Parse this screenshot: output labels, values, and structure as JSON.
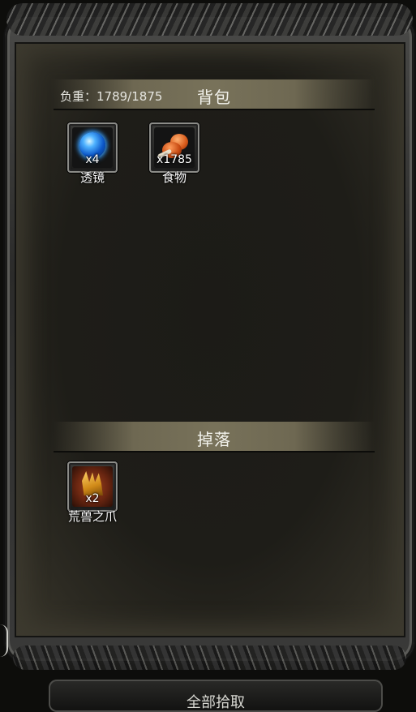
{
  "bag": {
    "weight_label": "负重：1789/1875",
    "title": "背包",
    "items": [
      {
        "name": "透镜",
        "count": "x4",
        "icon": "lens-icon"
      },
      {
        "name": "食物",
        "count": "x1785",
        "icon": "food-icon"
      }
    ]
  },
  "drop": {
    "title": "掉落",
    "items": [
      {
        "name": "荒兽之爪",
        "count": "x2",
        "icon": "claw-icon"
      }
    ]
  },
  "bottom": {
    "button_label": "全部拾取"
  },
  "colors": {
    "header_band": "#78725a",
    "panel_bg": "#1e1d18",
    "rare_slot": "#a0451e"
  }
}
